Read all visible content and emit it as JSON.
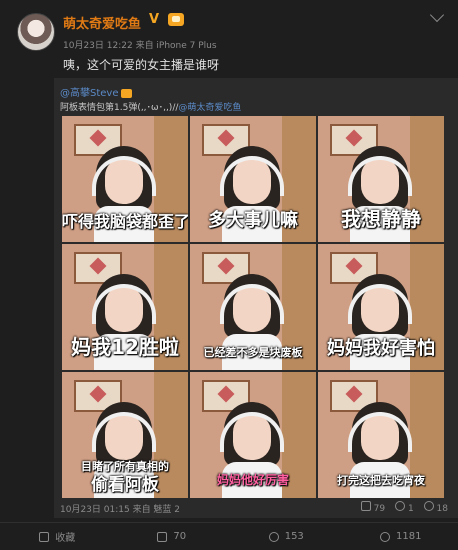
{
  "post": {
    "username": "萌太奇爱吃鱼",
    "verified_mark": "V",
    "meta": "10月23日 12:22 来自 iPhone 7 Plus",
    "text": "咦，这个可爱的女主播是谁呀"
  },
  "repost": {
    "author": "@高攀Steve",
    "text_prefix": "阿板表情包第1.5弹(,,･ω･,,)//",
    "text_mention": "@萌太奇爱吃鱼",
    "footer": "10月23日 01:15 来自 魅蓝 2",
    "stats": {
      "reposts": "79",
      "comments": "1",
      "likes": "18"
    },
    "images": [
      {
        "caption": "吓得我脑袋都歪了"
      },
      {
        "caption": "多大事儿嘛"
      },
      {
        "caption": "我想静静"
      },
      {
        "caption": "妈我12胜啦"
      },
      {
        "caption": "已经差不多是块废板"
      },
      {
        "caption": "妈妈我好害怕"
      },
      {
        "caption_line1": "目睹了所有真相的",
        "caption_line2": "偷看阿板"
      },
      {
        "caption": "妈妈他好厉害"
      },
      {
        "caption": "打完这把去吃宵夜"
      }
    ]
  },
  "actions": {
    "favorite": "收藏",
    "repost": "70",
    "comment": "153",
    "like": "1181"
  },
  "colors": {
    "username": "#e07a14",
    "link": "#5b8ac7",
    "background": "#1e1e1e"
  }
}
